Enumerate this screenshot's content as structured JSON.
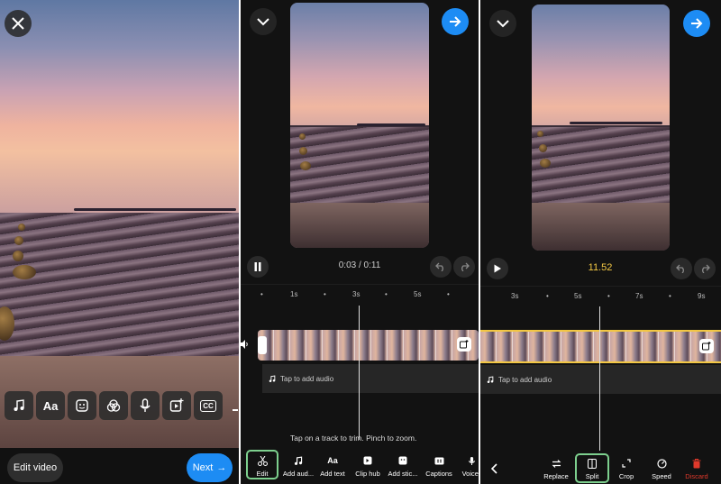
{
  "screen1": {
    "edit_video_label": "Edit video",
    "next_label": "Next",
    "next_arrow": "→",
    "tool_icons": [
      "music-icon",
      "text-icon",
      "sticker-icon",
      "filter-icon",
      "mic-icon",
      "add-clip-icon",
      "captions-icon"
    ],
    "text_tool_glyph": "Aa",
    "cc_glyph": "CC"
  },
  "screen2": {
    "time_display": "0:03 / 0:11",
    "ruler_labels": [
      "1s",
      "3s",
      "5s"
    ],
    "audio_placeholder": "Tap to add audio",
    "hint": "Tap on a track to trim. Pinch to zoom.",
    "bottom_tools": [
      {
        "label": "Edit",
        "icon": "scissors-icon"
      },
      {
        "label": "Add aud...",
        "icon": "music-icon"
      },
      {
        "label": "Add text",
        "icon": "text-icon",
        "glyph": "Aa"
      },
      {
        "label": "Clip hub",
        "icon": "clip-hub-icon"
      },
      {
        "label": "Add stic...",
        "icon": "sticker-icon"
      },
      {
        "label": "Captions",
        "icon": "captions-icon"
      },
      {
        "label": "Voice-",
        "icon": "mic-icon"
      }
    ]
  },
  "screen3": {
    "time_display": "11.52",
    "ruler_labels": [
      "3s",
      "5s",
      "7s",
      "9s"
    ],
    "audio_placeholder": "Tap to add audio",
    "bottom_tools": [
      {
        "label": "Replace",
        "icon": "replace-icon"
      },
      {
        "label": "Split",
        "icon": "split-icon"
      },
      {
        "label": "Crop",
        "icon": "crop-icon"
      },
      {
        "label": "Speed",
        "icon": "speed-icon"
      },
      {
        "label": "Discard",
        "icon": "trash-icon"
      }
    ]
  },
  "colors": {
    "accent_blue": "#1d8cf4",
    "time_yellow": "#f2c744",
    "selection_green": "#7dd08e",
    "discard_red": "#e0392b"
  }
}
